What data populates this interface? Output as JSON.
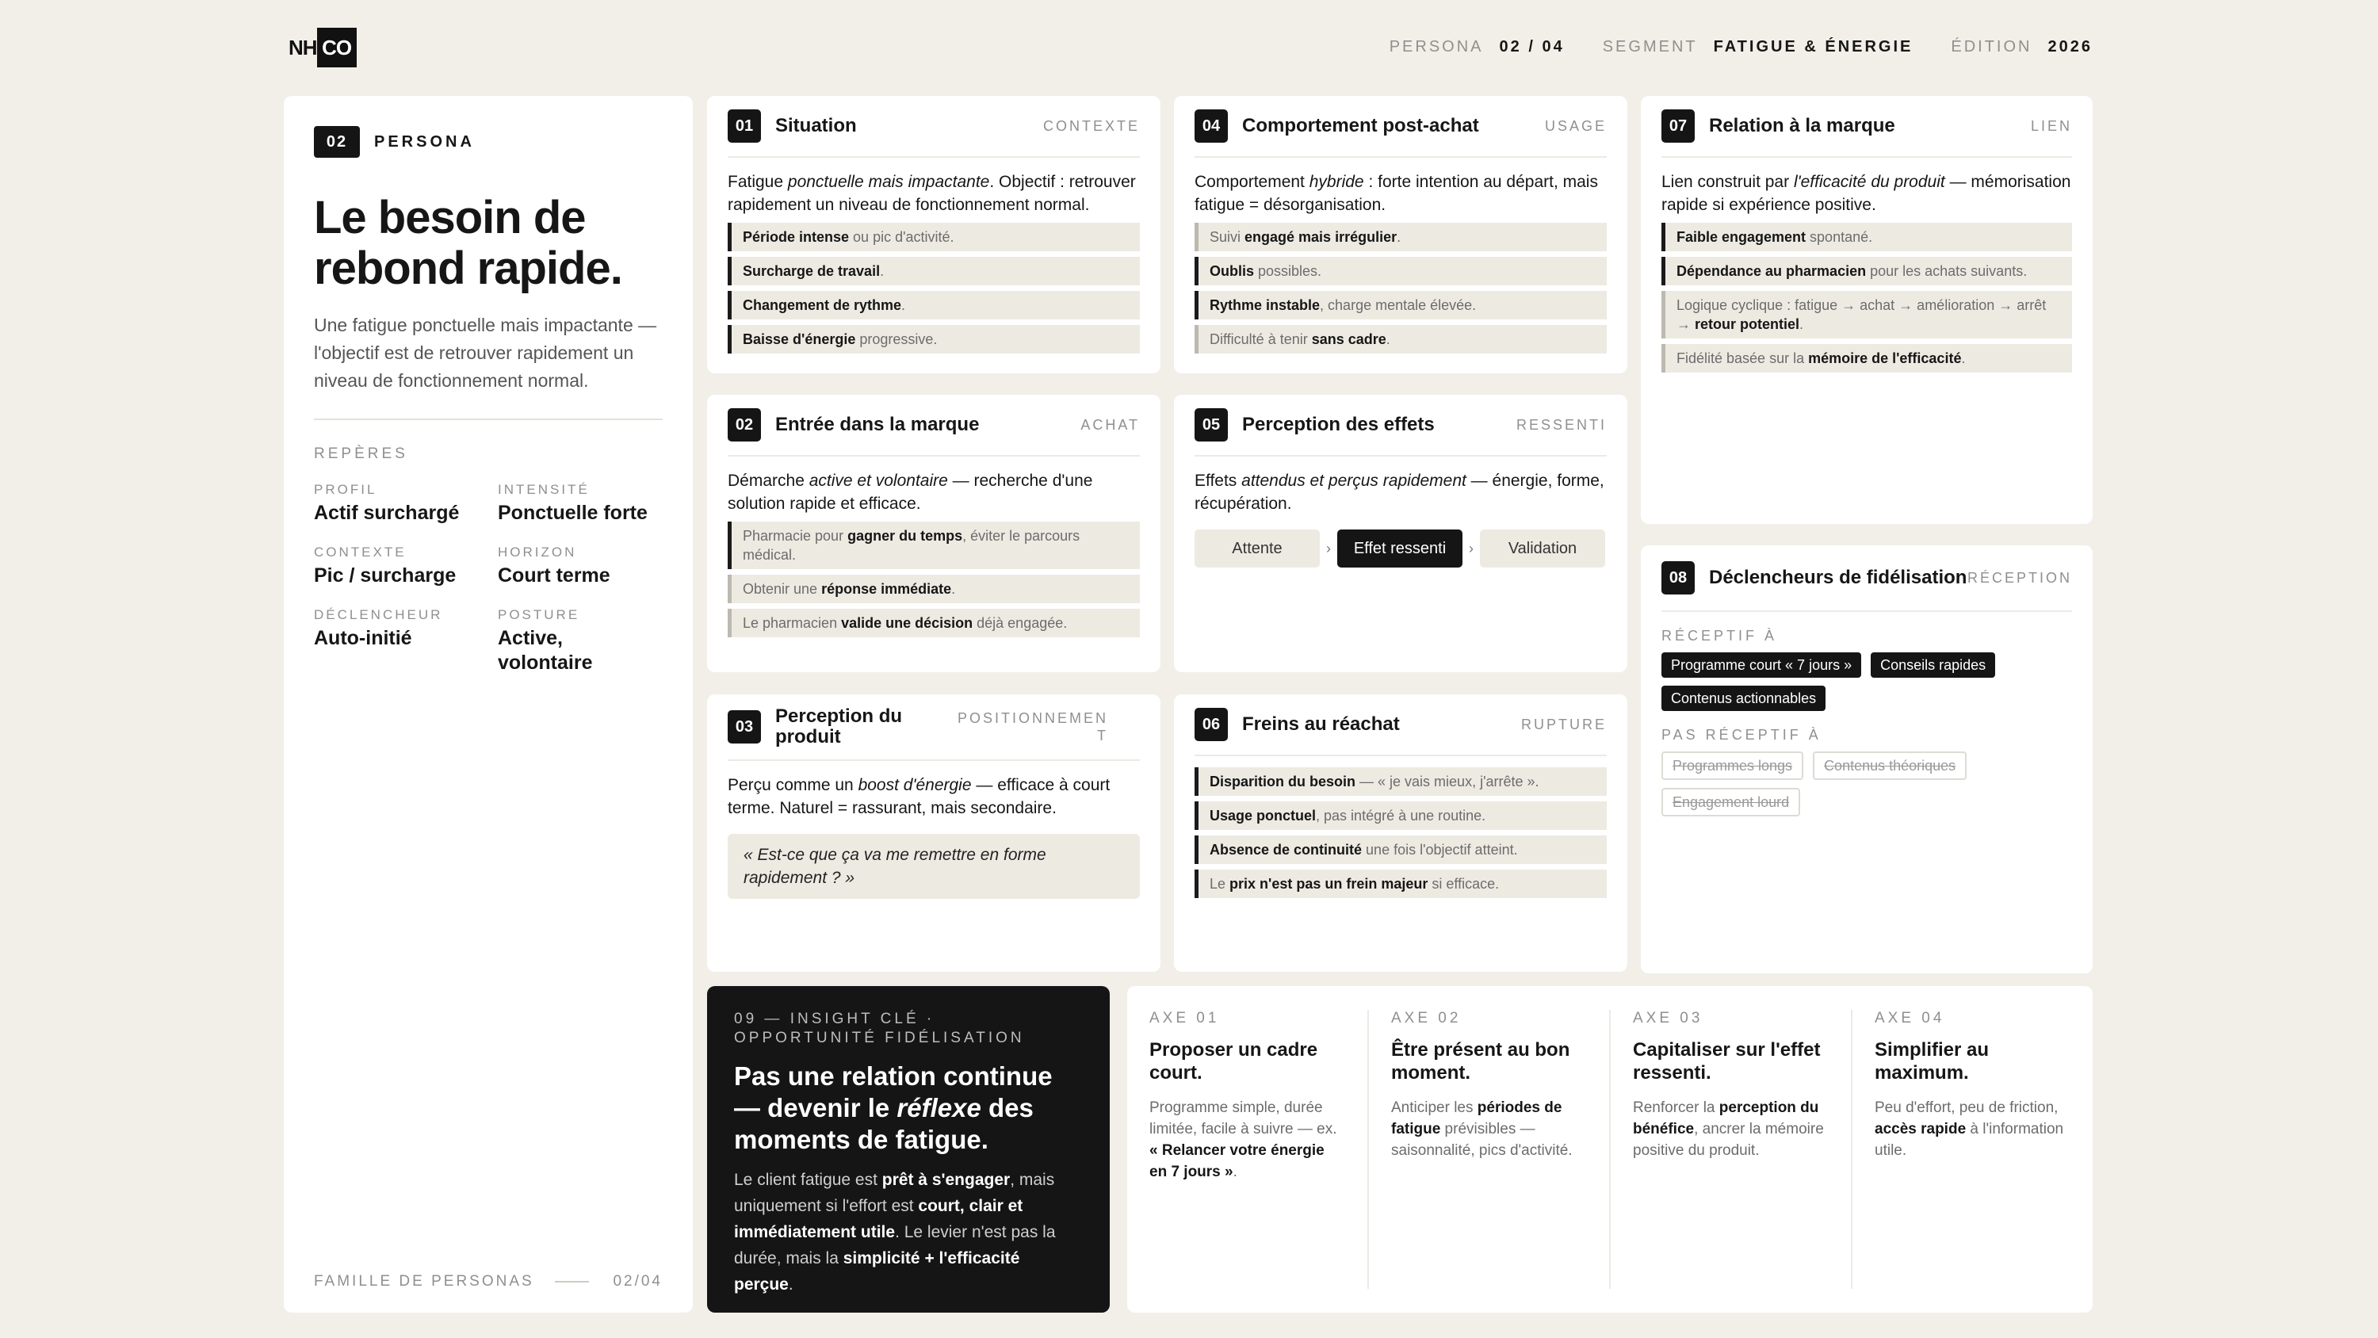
{
  "brand": {
    "nh": "NH",
    "co": "CO"
  },
  "meta": [
    {
      "k": "PERSONA",
      "v": "02 / 04"
    },
    {
      "k": "SEGMENT",
      "v": "FATIGUE & ÉNERGIE"
    },
    {
      "k": "ÉDITION",
      "v": "2026"
    }
  ],
  "persona": {
    "num": "02",
    "label": "PERSONA",
    "title": "Le besoin de rebond rapide.",
    "desc": "Une fatigue ponctuelle mais impactante — l'objectif est de retrouver rapidement un niveau de fonctionnement normal.",
    "reperes": "REPÈRES",
    "grid": [
      {
        "k": "PROFIL",
        "v": "Actif surchargé"
      },
      {
        "k": "INTENSITÉ",
        "v": "Ponctuelle forte"
      },
      {
        "k": "CONTEXTE",
        "v": "Pic / surcharge"
      },
      {
        "k": "HORIZON",
        "v": "Court terme"
      },
      {
        "k": "DÉCLENCHEUR",
        "v": "Auto-initié"
      },
      {
        "k": "POSTURE",
        "v": "Active, volontaire"
      }
    ],
    "footer_label": "FAMILLE DE PERSONAS",
    "footer_page": "02/04"
  },
  "c01": {
    "num": "01",
    "title": "Situation",
    "tag": "CONTEXTE",
    "intro": "Fatigue <i>ponctuelle mais impactante</i>. Objectif : retrouver rapidement un niveau de fonctionnement normal.",
    "items": [
      "<b>Période intense</b> ou pic d'activité.",
      "<b>Surcharge de travail</b>.",
      "<b>Changement de rythme</b>.",
      "<b>Baisse d'énergie</b> progressive."
    ]
  },
  "c02": {
    "num": "02",
    "title": "Entrée dans la marque",
    "tag": "ACHAT",
    "intro": "Démarche <i>active et volontaire</i> — recherche d'une solution rapide et efficace.",
    "items": [
      "Pharmacie pour <b>gagner du temps</b>, éviter le parcours médical.",
      "Obtenir une <b>réponse immédiate</b>.",
      "Le pharmacien <b>valide une décision</b> déjà engagée."
    ]
  },
  "c03": {
    "num": "03",
    "title": "Perception du produit",
    "tag": "POSITIONNEMENT",
    "intro": "Perçu comme un <i>boost d'énergie</i> — efficace à court terme. Naturel = rassurant, mais secondaire.",
    "quote": "« Est-ce que ça va me remettre en forme rapidement ? »"
  },
  "c04": {
    "num": "04",
    "title": "Comportement post-achat",
    "tag": "USAGE",
    "intro": "Comportement <i>hybride</i> : forte intention au départ, mais fatigue = désorganisation.",
    "items": [
      "Suivi <b>engagé mais irrégulier</b>.",
      "<b>Oublis</b> possibles.",
      "<b>Rythme instable</b>, charge mentale élevée.",
      "Difficulté à tenir <b>sans cadre</b>."
    ]
  },
  "c05": {
    "num": "05",
    "title": "Perception des effets",
    "tag": "RESSENTI",
    "intro": "Effets <i>attendus et perçus rapidement</i> — énergie, forme, récupération.",
    "steps": [
      "Attente",
      "Effet ressenti",
      "Validation"
    ],
    "arrow": "›"
  },
  "c06": {
    "num": "06",
    "title": "Freins au réachat",
    "tag": "RUPTURE",
    "items": [
      "<b>Disparition du besoin</b> — « je vais mieux, j'arrête ».",
      "<b>Usage ponctuel</b>, pas intégré à une routine.",
      "<b>Absence de continuité</b> une fois l'objectif atteint.",
      "Le <b>prix n'est pas un frein majeur</b> si efficace."
    ]
  },
  "c07": {
    "num": "07",
    "title": "Relation à la marque",
    "tag": "LIEN",
    "intro": "Lien construit par <i>l'efficacité du produit</i> — mémorisation rapide si expérience positive.",
    "items": [
      "<b>Faible engagement</b> spontané.",
      "<b>Dépendance au pharmacien</b> pour les achats suivants.",
      "Logique cyclique : fatigue → achat → amélioration → arrêt → <b>retour potentiel</b>.",
      "Fidélité basée sur la <b>mémoire de l'efficacité</b>."
    ]
  },
  "c08": {
    "num": "08",
    "title": "Déclencheurs de fidélisation",
    "tag": "RÉCEPTION",
    "rec_label": "RÉCEPTIF À",
    "rec": [
      "Programme court « 7 jours »",
      "Conseils rapides",
      "Contenus actionnables"
    ],
    "nrec_label": "PAS RÉCEPTIF À",
    "nrec": [
      "Programmes longs",
      "Contenus théoriques",
      "Engagement lourd"
    ]
  },
  "insight": {
    "kicker": "09 — INSIGHT CLÉ · OPPORTUNITÉ FIDÉLISATION",
    "headline": "Pas une relation continue — devenir le <i>réflexe</i> des moments de fatigue.",
    "body": "Le client fatigue est <b>prêt à s'engager</b>, mais uniquement si l'effort est <b>court, clair et immédiatement utile</b>. Le levier n'est pas la durée, mais la <b>simplicité + l'efficacité perçue</b>."
  },
  "axes": [
    {
      "k": "AXE 01",
      "h": "Proposer un cadre court.",
      "b": "Programme simple, durée limitée, facile à suivre — ex. <b>« Relancer votre énergie en 7 jours »</b>."
    },
    {
      "k": "AXE 02",
      "h": "Être présent au bon moment.",
      "b": "Anticiper les <b>périodes de fatigue</b> prévisibles — saisonnalité, pics d'activité."
    },
    {
      "k": "AXE 03",
      "h": "Capitaliser sur l'effet ressenti.",
      "b": "Renforcer la <b>perception du bénéfice</b>, ancrer la mémoire positive du produit."
    },
    {
      "k": "AXE 04",
      "h": "Simplifier au maximum.",
      "b": "Peu d'effort, peu de friction, <b>accès rapide</b> à l'information utile."
    }
  ]
}
